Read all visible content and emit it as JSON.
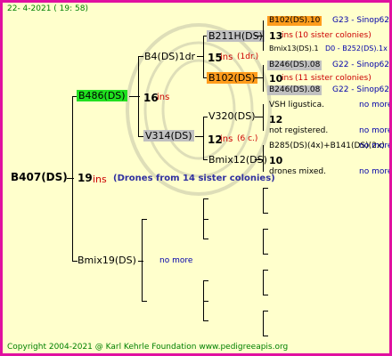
{
  "header": {
    "date": "22-  4-2021  ( 19: 58)"
  },
  "root": {
    "name": "B407(DS)",
    "ins_num": "19",
    "ins_label": "ins",
    "sister_note": "(Drones from 14 sister colonies)"
  },
  "gen1": {
    "top": {
      "name": "B486(DS)",
      "ins_num": "16",
      "ins_label": "ins"
    },
    "bottom": {
      "name": "Bmix19(DS)",
      "note": "no more"
    }
  },
  "gen2": {
    "a": {
      "name": "B4(DS)1dr",
      "ins_num": "15",
      "ins_label": "ins",
      "extra": "(1dr.)"
    },
    "b": {
      "name": "V314(DS)",
      "ins_num": "12",
      "ins_label": "ins",
      "extra": "(6 c.)"
    }
  },
  "gen3": {
    "a": {
      "name": "B211H(DS)"
    },
    "b": {
      "name": "B102(DS)"
    },
    "c": {
      "name": "V320(DS)"
    },
    "d": {
      "name": "Bmix12(DS)",
      "num": "10"
    }
  },
  "gen4": {
    "r1": {
      "name": "B102(DS).10",
      "info": "G23 - Sinop62R"
    },
    "r2": {
      "num": "13",
      "ins_label": "ins",
      "extra": "(10 sister colonies)"
    },
    "r3": {
      "text": "Bmix13(DS).1",
      "info": "D0 - B252(DS).1x"
    },
    "r4": {
      "name": "B246(DS).08",
      "info": "G22 - Sinop62R"
    },
    "r5": {
      "num": "10",
      "ins_label": "ins",
      "extra": "(11 sister colonies)"
    },
    "r6": {
      "name": "B246(DS).08",
      "info": "G22 - Sinop62R"
    },
    "r7": {
      "text": "VSH ligustica.",
      "info": "no more"
    },
    "r8": {
      "num": "12"
    },
    "r9": {
      "text": "not registered.",
      "info": "no more"
    },
    "r10": {
      "text": "B285(DS)(4x)+B141(DS)(2x)",
      "info": "no more"
    },
    "r11": {
      "num": "10"
    },
    "r12": {
      "text": "drones mixed.",
      "info": "no more"
    }
  },
  "footer": {
    "copyright": "Copyright 2004-2021 @ Karl Kehrle Foundation    www.pedigreeapis.org"
  },
  "colors": {
    "frame": "#e010a0",
    "background": "#ffffcc",
    "highlight_green": "#20e020",
    "highlight_grey": "#c0c0c0",
    "highlight_orange": "#ff9c1c",
    "ins": "#cc0000",
    "info_blue": "#0000aa"
  }
}
